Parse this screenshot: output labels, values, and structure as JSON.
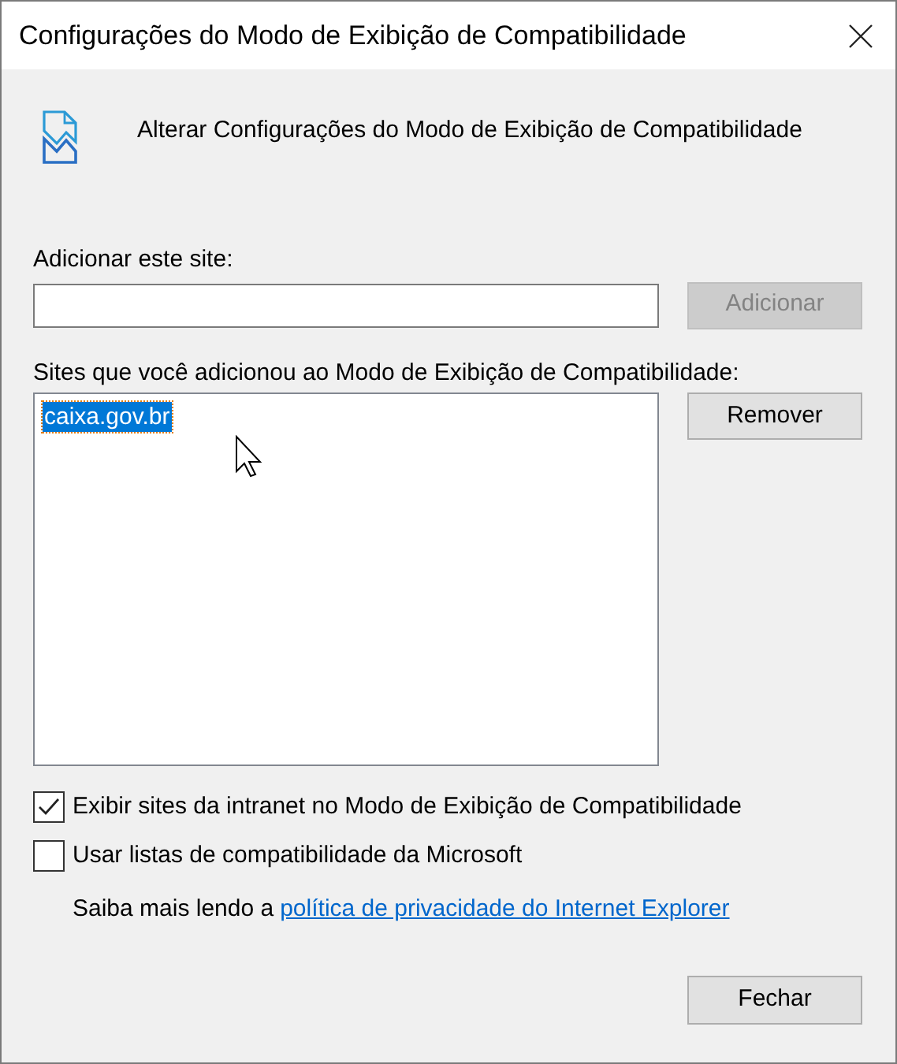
{
  "window": {
    "title": "Configurações do Modo de Exibição de Compatibilidade"
  },
  "header": "Alterar Configurações do Modo de Exibição de Compatibilidade",
  "add_site": {
    "label": "Adicionar este site:"
  },
  "add_button": {
    "label": "Adicionar",
    "disabled": true
  },
  "sites": {
    "label": "Sites que você adicionou ao Modo de Exibição de Compatibilidade:",
    "items": [
      {
        "text": "caixa.gov.br",
        "selected": true
      }
    ]
  },
  "remove_button": {
    "label": "Remover",
    "disabled": false
  },
  "options": [
    {
      "label": "Exibir sites da intranet no Modo de Exibição de Compatibilidade",
      "checked": true
    },
    {
      "label": "Usar listas de compatibilidade da Microsoft",
      "checked": false
    }
  ],
  "privacy_note": {
    "text": "Saiba mais lendo a",
    "link": "política de privacidade do Internet Explorer"
  },
  "close_button": {
    "label": "Fechar"
  }
}
